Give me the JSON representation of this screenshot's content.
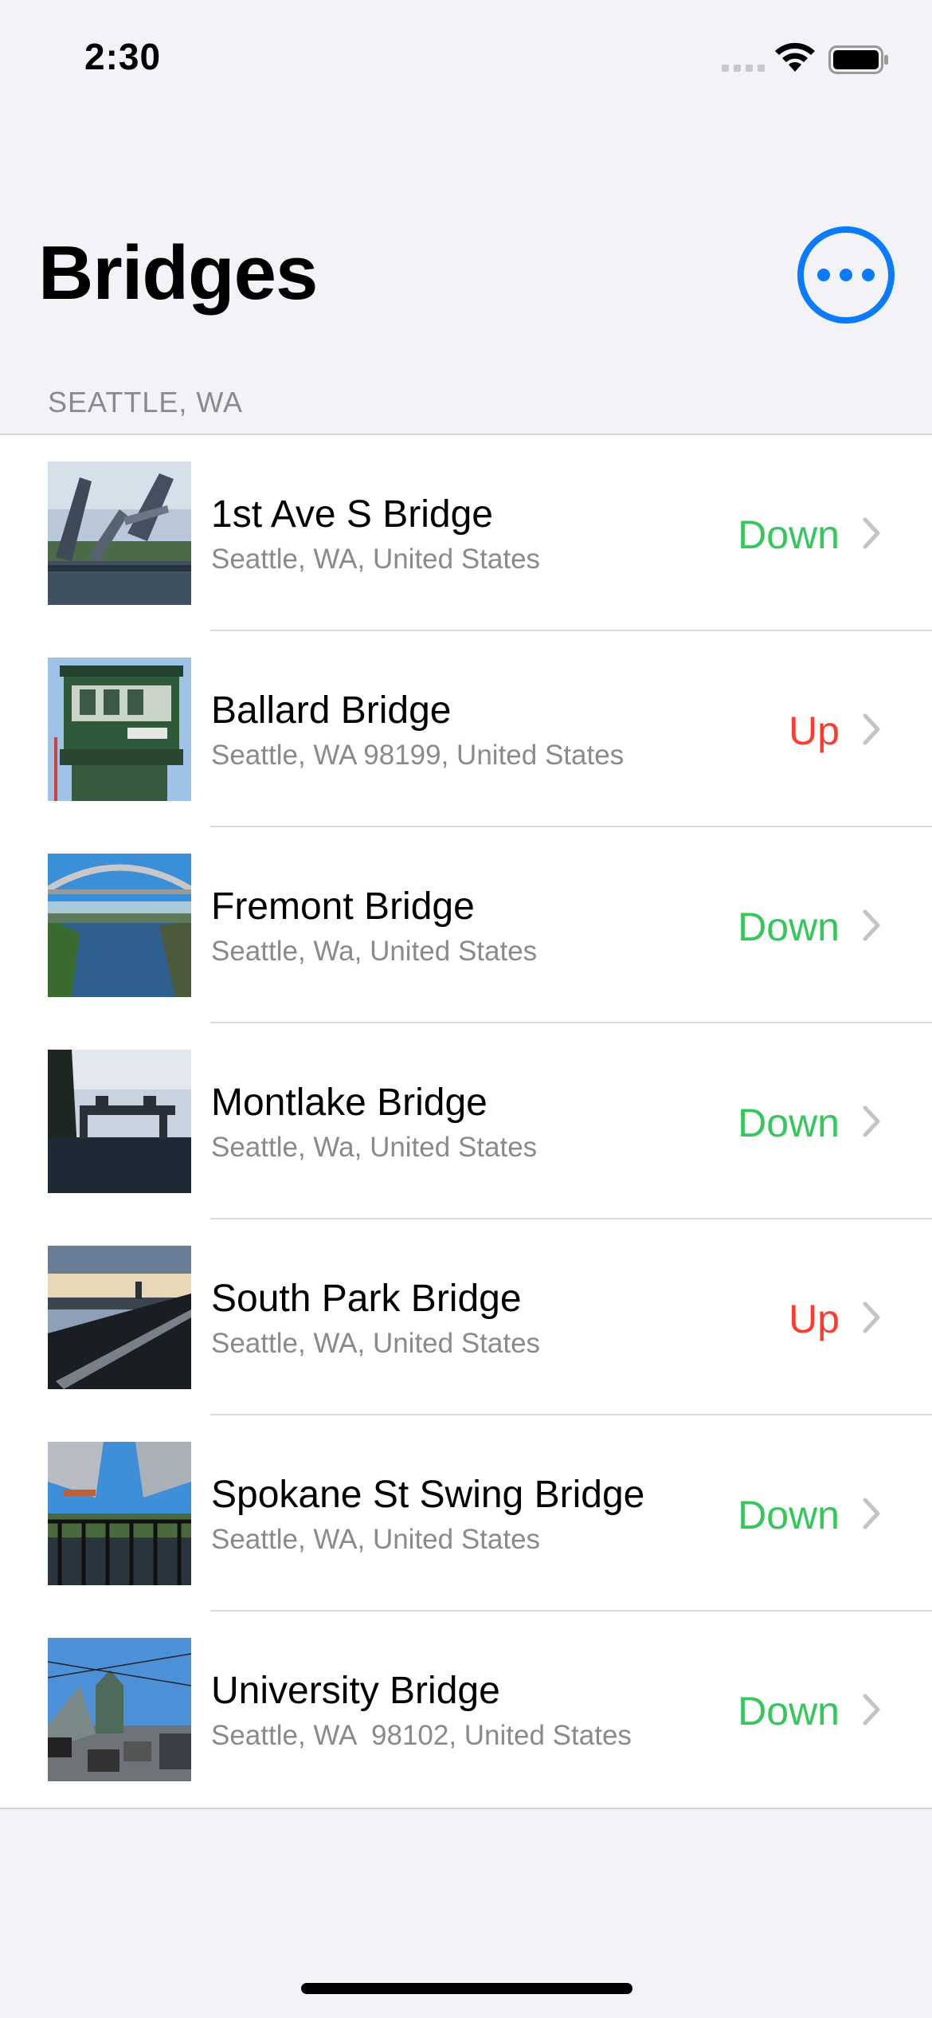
{
  "status_bar": {
    "time": "2:30"
  },
  "header": {
    "title": "Bridges",
    "more_icon": "ellipsis-circle-icon"
  },
  "section": {
    "title": "SEATTLE, WA"
  },
  "colors": {
    "accent": "#0a7aff",
    "down": "#34c759",
    "up": "#ff3b30"
  },
  "bridges": [
    {
      "name": "1st Ave S Bridge",
      "location": "Seattle, WA, United States",
      "status": "Down"
    },
    {
      "name": "Ballard Bridge",
      "location": "Seattle, WA 98199, United States",
      "status": "Up"
    },
    {
      "name": "Fremont Bridge",
      "location": "Seattle, Wa, United States",
      "status": "Down"
    },
    {
      "name": "Montlake Bridge",
      "location": "Seattle, Wa, United States",
      "status": "Down"
    },
    {
      "name": "South Park Bridge",
      "location": "Seattle, WA, United States",
      "status": "Up"
    },
    {
      "name": "Spokane St Swing Bridge",
      "location": "Seattle, WA, United States",
      "status": "Down"
    },
    {
      "name": "University Bridge",
      "location": "Seattle, WA  98102, United States",
      "status": "Down"
    }
  ]
}
